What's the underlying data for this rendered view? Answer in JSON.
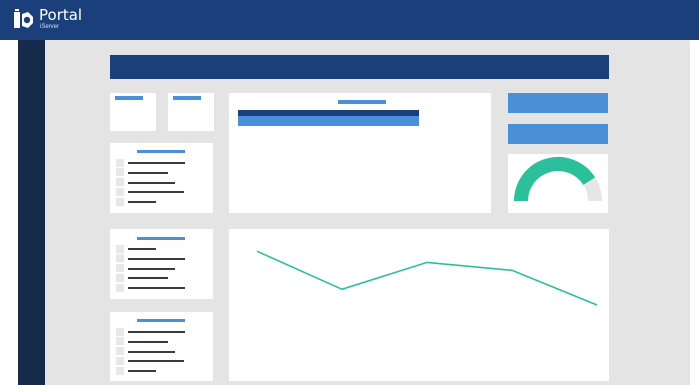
{
  "app": {
    "name": "Portal",
    "subtitle": "iServer",
    "icon": "portal-logo-icon"
  },
  "colors": {
    "topbar": "#1b3f7a",
    "sidebar": "#162a4c",
    "canvas": "#e4e4e4",
    "accent_blue": "#4a90d9",
    "gauge_fill": "#2bbf9b",
    "gauge_track": "#e6e6e6",
    "line_series": "#2bbf9b"
  },
  "gauge": {
    "value": 0.82
  },
  "line_chart": {
    "values": [
      0.96,
      0.28,
      0.76,
      0.62,
      0.0
    ]
  }
}
